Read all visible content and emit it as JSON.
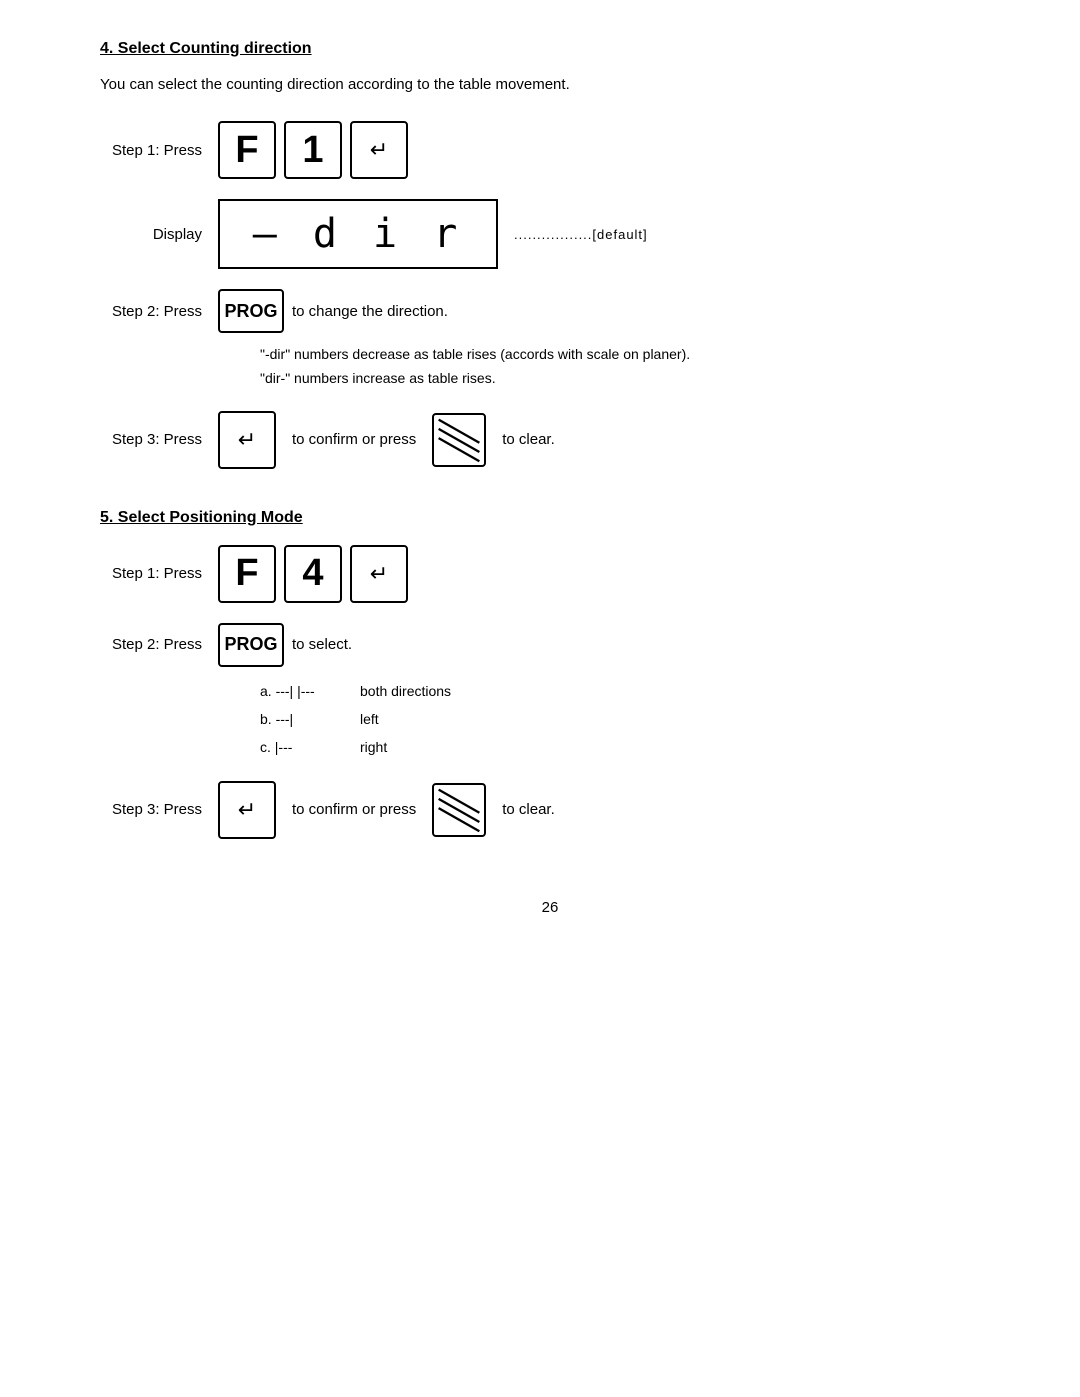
{
  "section4": {
    "title": "4. Select Counting direction",
    "desc": "You can select the counting direction according to the table movement.",
    "step1_label": "Step 1:  Press",
    "step1_keys": [
      "F",
      "1",
      "↵"
    ],
    "display_label": "Display",
    "display_value": "— d i r",
    "default_text": ".................[default]",
    "step2_label": "Step 2:  Press",
    "step2_prog": "PROG",
    "step2_text": "to change the direction.",
    "note1": "\"-dir\"   numbers decrease as table rises (accords with scale on planer).",
    "note2": "\"dir-\"   numbers increase as table rises.",
    "step3_label": "Step 3:  Press",
    "step3_confirm": "to confirm or press",
    "step3_clear": "to clear."
  },
  "section5": {
    "title": "5. Select Positioning Mode",
    "step1_label": "Step 1:  Press",
    "step1_keys": [
      "F",
      "4",
      "↵"
    ],
    "step2_label": "Step 2:  Press",
    "step2_prog": "PROG",
    "step2_text": "to select.",
    "options": [
      {
        "code": "a.  ---| |---",
        "desc": "both directions"
      },
      {
        "code": "b.  ---|",
        "desc": "left"
      },
      {
        "code": "c.  |---",
        "desc": "right"
      }
    ],
    "step3_label": "Step 3:  Press",
    "step3_confirm": "to confirm or press",
    "step3_clear": "to clear."
  },
  "page_number": "26"
}
